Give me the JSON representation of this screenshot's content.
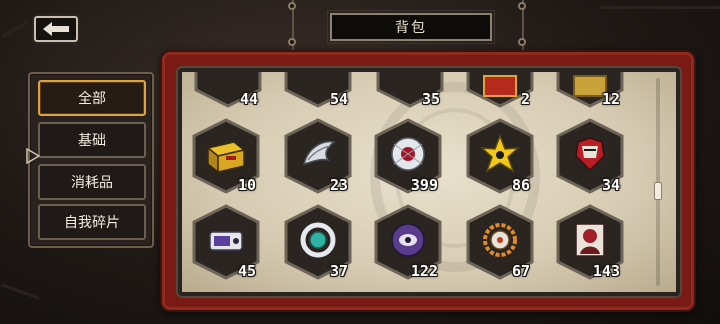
{
  "header": {
    "title": "背包"
  },
  "tabs": [
    {
      "label": "全部",
      "active": true
    },
    {
      "label": "基础",
      "active": false
    },
    {
      "label": "消耗品",
      "active": false
    },
    {
      "label": "自我碎片",
      "active": false
    }
  ],
  "items": {
    "row_top_partial": [
      {
        "count": "44",
        "icon": "partial-item-icon"
      },
      {
        "count": "54",
        "icon": "partial-item-icon"
      },
      {
        "count": "35",
        "icon": "partial-item-icon"
      },
      {
        "count": "2",
        "icon": "red-chest-icon"
      },
      {
        "count": "12",
        "icon": "gold-box-icon"
      }
    ],
    "row_1": [
      {
        "count": "10",
        "icon": "yellow-supply-box-icon"
      },
      {
        "count": "23",
        "icon": "silver-wing-icon"
      },
      {
        "count": "399",
        "icon": "crimson-eye-orb-icon"
      },
      {
        "count": "86",
        "icon": "yellow-star-burst-icon"
      },
      {
        "count": "34",
        "icon": "red-armor-icon"
      }
    ],
    "row_2": [
      {
        "count": "45",
        "icon": "purple-device-icon"
      },
      {
        "count": "37",
        "icon": "teal-ring-icon"
      },
      {
        "count": "122",
        "icon": "purple-mask-orb-icon"
      },
      {
        "count": "67",
        "icon": "orange-gear-ring-icon"
      },
      {
        "count": "143",
        "icon": "crimson-portrait-icon"
      }
    ]
  },
  "colors": {
    "accent": "#e0a23c",
    "frame": "#7a1a14",
    "paper": "#e1d8c3"
  }
}
